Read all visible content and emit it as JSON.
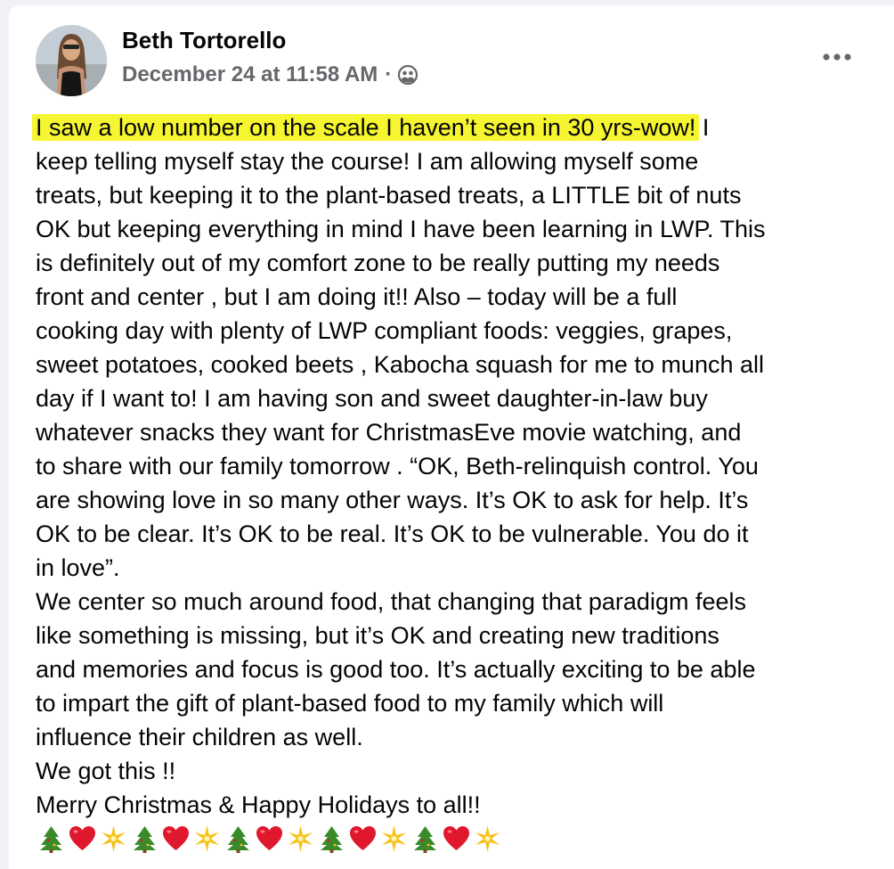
{
  "post": {
    "author": "Beth Tortorello",
    "timestamp": "December 24 at 11:58 AM",
    "separator": "·",
    "highlight": "I saw a  low number on the scale I haven’t seen in 30 yrs-wow!",
    "lines": [
      " I",
      "keep telling myself stay the course! I am allowing myself some",
      "treats, but keeping it to the plant-based treats, a LITTLE bit of nuts",
      "OK but keeping everything in mind I have been learning in LWP. This",
      "is definitely out of my comfort zone to be really putting my needs",
      "front and center , but I am doing it!! Also – today will be a full",
      "cooking day with plenty of LWP compliant foods: veggies, grapes,",
      "sweet potatoes, cooked beets , Kabocha squash for me to munch all",
      "day if I want to! I am having son and sweet daughter-in-law buy",
      "whatever snacks they want for ChristmasEve movie watching, and",
      "to share with our family tomorrow . “OK, Beth-relinquish control. You",
      "are showing love in so many other ways. It’s OK to ask for help. It’s",
      "OK to be clear. It’s OK to be real. It’s OK to be vulnerable. You do it",
      "in love”.",
      "We center so much around food, that changing that paradigm feels",
      "like something is missing, but it’s OK and creating new traditions",
      "and memories and focus is good too. It’s actually exciting to be able",
      "to impart the gift of plant-based food to my family which will",
      "influence their children as well.",
      "We got this !!",
      "Merry Christmas & Happy Holidays to all!!"
    ],
    "emoji_sequence": [
      "christmas-tree",
      "heart",
      "sparkle",
      "christmas-tree",
      "heart",
      "sparkle",
      "christmas-tree",
      "heart",
      "sparkle",
      "christmas-tree",
      "heart",
      "sparkle",
      "christmas-tree",
      "heart",
      "sparkle"
    ]
  },
  "icons": {
    "privacy": "friends-icon",
    "menu": "more-options-icon"
  },
  "colors": {
    "text": "#050505",
    "secondary": "#65676b",
    "highlight": "#f5f531",
    "heart": "#e0182d",
    "tree": "#3a8a2a",
    "sparkle": "#f6c21a"
  }
}
